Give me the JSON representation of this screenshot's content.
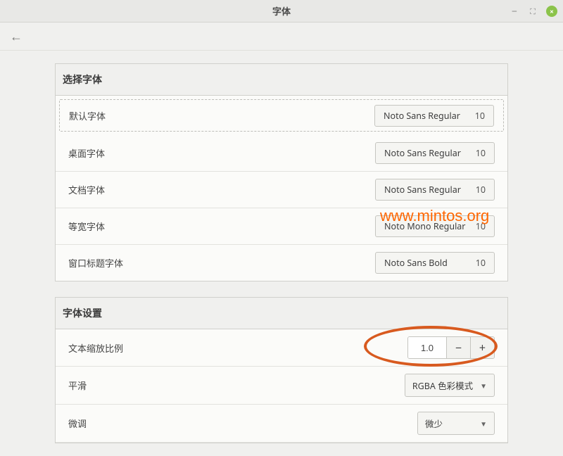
{
  "window": {
    "title": "字体"
  },
  "section1": {
    "header": "选择字体",
    "rows": [
      {
        "label": "默认字体",
        "font": "Noto Sans Regular",
        "size": "10"
      },
      {
        "label": "桌面字体",
        "font": "Noto Sans Regular",
        "size": "10"
      },
      {
        "label": "文档字体",
        "font": "Noto Sans Regular",
        "size": "10"
      },
      {
        "label": "等宽字体",
        "font": "Noto Mono Regular",
        "size": "10"
      },
      {
        "label": "窗口标题字体",
        "font": "Noto Sans Bold",
        "size": "10"
      }
    ]
  },
  "section2": {
    "header": "字体设置",
    "scale_label": "文本缩放比例",
    "scale_value": "1.0",
    "antialias_label": "平滑",
    "antialias_value": "RGBA 色彩模式",
    "hinting_label": "微调",
    "hinting_value": "微少"
  },
  "watermark": "www.mintos.org"
}
